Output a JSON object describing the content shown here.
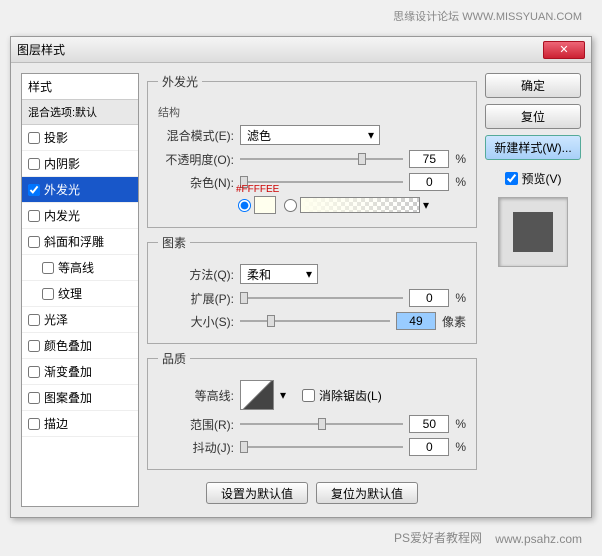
{
  "watermarks": {
    "top": "思缘设计论坛  WWW.MISSYUAN.COM",
    "bottom1": "PS爱好者教程网",
    "bottom2": "www.psahz.com"
  },
  "dialog": {
    "title": "图层样式"
  },
  "styleList": {
    "header": "样式",
    "blendDefault": "混合选项:默认",
    "items": [
      {
        "label": "投影",
        "checked": false
      },
      {
        "label": "内阴影",
        "checked": false
      },
      {
        "label": "外发光",
        "checked": true,
        "selected": true
      },
      {
        "label": "内发光",
        "checked": false
      },
      {
        "label": "斜面和浮雕",
        "checked": false
      },
      {
        "label": "等高线",
        "checked": false,
        "indent": true
      },
      {
        "label": "纹理",
        "checked": false,
        "indent": true
      },
      {
        "label": "光泽",
        "checked": false
      },
      {
        "label": "颜色叠加",
        "checked": false
      },
      {
        "label": "渐变叠加",
        "checked": false
      },
      {
        "label": "图案叠加",
        "checked": false
      },
      {
        "label": "描边",
        "checked": false
      }
    ]
  },
  "panel": {
    "title": "外发光",
    "structure": {
      "label": "结构",
      "blendMode": {
        "label": "混合模式(E):",
        "value": "滤色"
      },
      "opacity": {
        "label": "不透明度(O):",
        "value": "75",
        "unit": "%"
      },
      "noise": {
        "label": "杂色(N):",
        "value": "0",
        "unit": "%"
      },
      "colorHex": "#FFFFEE"
    },
    "elements": {
      "label": "图素",
      "technique": {
        "label": "方法(Q):",
        "value": "柔和"
      },
      "spread": {
        "label": "扩展(P):",
        "value": "0",
        "unit": "%"
      },
      "size": {
        "label": "大小(S):",
        "value": "49",
        "unit": "像素"
      }
    },
    "quality": {
      "label": "品质",
      "contour": {
        "label": "等高线:"
      },
      "antialias": {
        "label": "消除锯齿(L)",
        "checked": false
      },
      "range": {
        "label": "范围(R):",
        "value": "50",
        "unit": "%"
      },
      "jitter": {
        "label": "抖动(J):",
        "value": "0",
        "unit": "%"
      }
    },
    "buttons": {
      "reset": "设置为默认值",
      "revert": "复位为默认值"
    }
  },
  "rightPanel": {
    "ok": "确定",
    "cancel": "复位",
    "newStyle": "新建样式(W)...",
    "preview": {
      "label": "预览(V)",
      "checked": true
    }
  }
}
